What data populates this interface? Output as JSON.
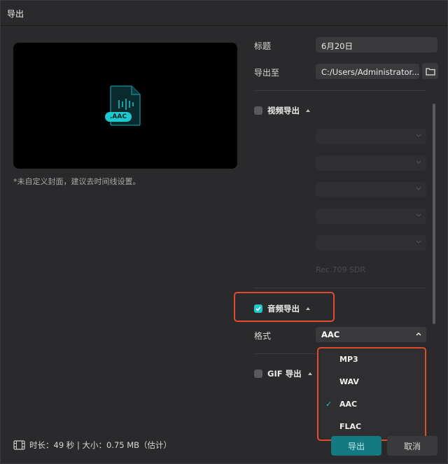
{
  "window": {
    "title": "导出"
  },
  "preview": {
    "badge": ".AAC",
    "cover_note": "*未自定义封面，建议去时间线设置。"
  },
  "form": {
    "title_label": "标题",
    "title_value": "6月20日",
    "export_to_label": "导出至",
    "export_to_value": "C:/Users/Administrator...",
    "folder_icon": "folder-icon"
  },
  "video_export": {
    "label": "视频导出",
    "checked": false,
    "color_space": "Rec.709 SDR"
  },
  "audio_export": {
    "label": "音频导出",
    "checked": true,
    "format_label": "格式",
    "format_value": "AAC",
    "options": [
      "MP3",
      "WAV",
      "AAC",
      "FLAC"
    ],
    "selected_option": "AAC"
  },
  "gif_export": {
    "label": "GIF 导出",
    "checked": false
  },
  "footer": {
    "info": "时长：49 秒 | 大小：0.75 MB（估计）",
    "export_button": "导出",
    "cancel_button": "取消"
  },
  "colors": {
    "accent": "#1ec8cf",
    "highlight": "#e24b2e",
    "primary_button": "#137a82"
  }
}
